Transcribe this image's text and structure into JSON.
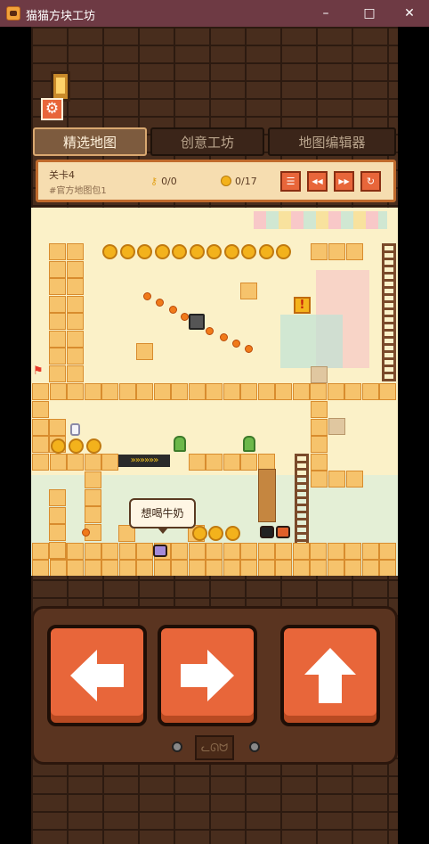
{
  "window": {
    "title": "猫猫方块工坊",
    "minimize": "–",
    "maximize": "□",
    "close": "✕"
  },
  "toolbar": {
    "settings_icon": "gear-icon"
  },
  "tabs": [
    {
      "label": "精选地图",
      "active": true
    },
    {
      "label": "创意工坊",
      "active": false
    },
    {
      "label": "地图编辑器",
      "active": false
    }
  ],
  "level": {
    "name": "关卡4",
    "pack": "#官方地图包1",
    "keys": "0/0",
    "coins": "0/17"
  },
  "level_controls": [
    {
      "name": "menu",
      "icon": "menu-icon",
      "glyph": "☰"
    },
    {
      "name": "rewind",
      "icon": "rewind-icon",
      "glyph": "◀◀"
    },
    {
      "name": "fast-forward",
      "icon": "fast-forward-icon",
      "glyph": "▶▶"
    },
    {
      "name": "restart",
      "icon": "restart-icon",
      "glyph": "↻"
    }
  ],
  "board": {
    "speech_bubble": "想喝牛奶",
    "conveyor_glyph": "»»»»»»",
    "exclaim_glyph": "!"
  },
  "controls": [
    {
      "name": "left",
      "icon": "arrow-left-icon"
    },
    {
      "name": "right",
      "icon": "arrow-right-icon"
    },
    {
      "name": "jump",
      "icon": "arrow-up-icon"
    }
  ],
  "colors": {
    "titlebar": "#6e3a44",
    "accent": "#e8663a",
    "board_bg": "#fbf1c8"
  }
}
